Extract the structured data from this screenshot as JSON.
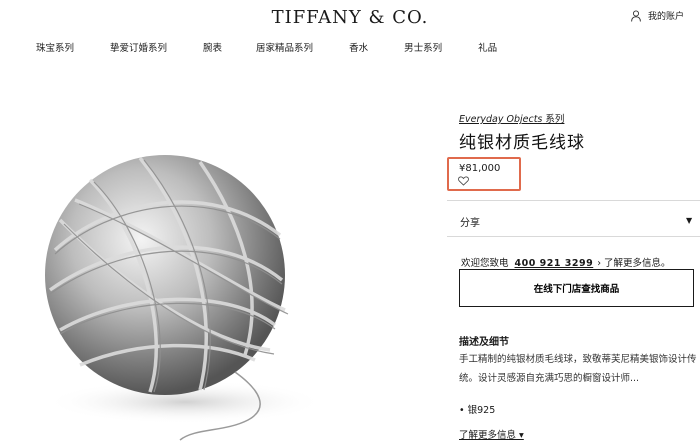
{
  "header": {
    "logo": "TIFFANY & CO.",
    "account_label": "我的账户",
    "account_icon": "person-icon"
  },
  "nav": {
    "items": [
      "珠宝系列",
      "挚爱订婚系列",
      "腕表",
      "居家精品系列",
      "香水",
      "男士系列",
      "礼品"
    ]
  },
  "product": {
    "image_icon": "yarn-ball-image",
    "collection": "Everyday Objects",
    "collection_suffix": " 系列",
    "title": "纯银材质毛线球",
    "price": "¥81,000",
    "wishlist_icon": "heart-icon",
    "highlight_color": "#e06a4c"
  },
  "share": {
    "label": "分享",
    "caret": "▼"
  },
  "contact": {
    "prefix": "欢迎您致电",
    "phone": "400 921 3299",
    "arrow": "›",
    "suffix": "了解更多信息。"
  },
  "store_button": "在线下门店查找商品",
  "description": {
    "heading": "描述及细节",
    "text": "手工精制的纯银材质毛线球，致敬蒂芙尼精美银饰设计传统。设计灵感源自充满巧思的橱窗设计师...",
    "spec": "• 银925",
    "more": "了解更多信息 ▾"
  }
}
